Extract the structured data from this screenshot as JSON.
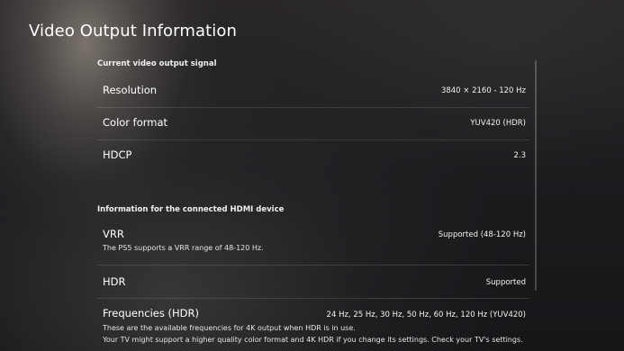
{
  "title": "Video Output Information",
  "sections": [
    {
      "header": "Current video output signal",
      "rows": [
        {
          "label": "Resolution",
          "value": "3840 × 2160 - 120 Hz"
        },
        {
          "label": "Color format",
          "value": "YUV420 (HDR)"
        },
        {
          "label": "HDCP",
          "value": "2.3"
        }
      ]
    },
    {
      "header": "Information for the connected HDMI device",
      "rows": [
        {
          "label": "VRR",
          "value": "Supported (48-120 Hz)",
          "description": "The PS5 supports a VRR range of 48-120 Hz."
        },
        {
          "label": "HDR",
          "value": "Supported"
        },
        {
          "label": "Frequencies (HDR)",
          "value": "24 Hz, 25 Hz, 30 Hz, 50 Hz, 60 Hz, 120 Hz (YUV420)",
          "description_lines": [
            "These are the available frequencies for 4K output when HDR is in use.",
            "Your TV might support a higher quality color format and 4K HDR if you change its settings. Check your TV's settings."
          ]
        }
      ]
    }
  ]
}
